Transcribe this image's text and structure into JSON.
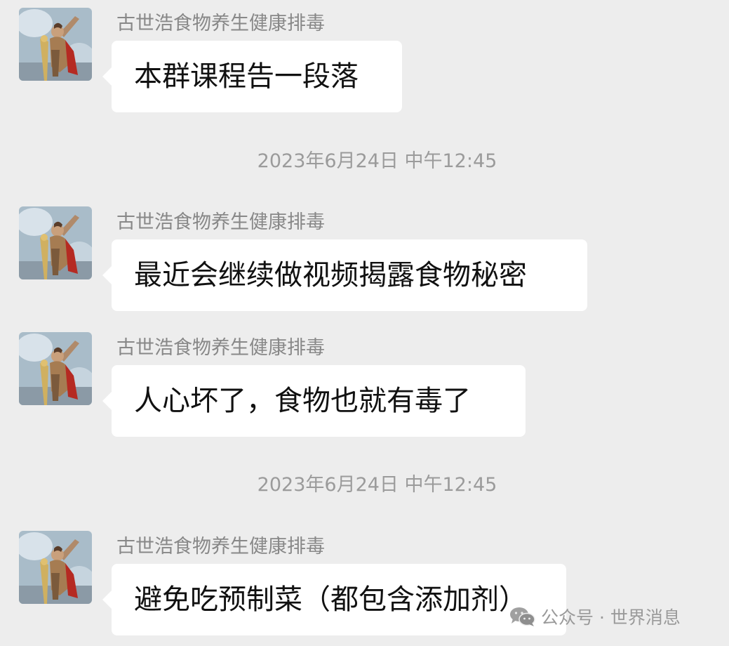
{
  "messages": [
    {
      "sender": "古世浩食物养生健康排毒",
      "text": "本群课程告一段落"
    },
    {
      "sender": "古世浩食物养生健康排毒",
      "text": "最近会继续做视频揭露食物秘密"
    },
    {
      "sender": "古世浩食物养生健康排毒",
      "text": "人心坏了，食物也就有毒了"
    },
    {
      "sender": "古世浩食物养生健康排毒",
      "text": "避免吃预制菜（都包含添加剂）"
    }
  ],
  "timestamps": [
    "2023年6月24日 中午12:45",
    "2023年6月24日 中午12:45"
  ],
  "watermark": {
    "icon": "wechat-icon",
    "text": "公众号 · 世界消息"
  },
  "colors": {
    "background": "#ededed",
    "bubble": "#ffffff",
    "sender": "#888888",
    "timestamp": "#9b9b9b"
  }
}
